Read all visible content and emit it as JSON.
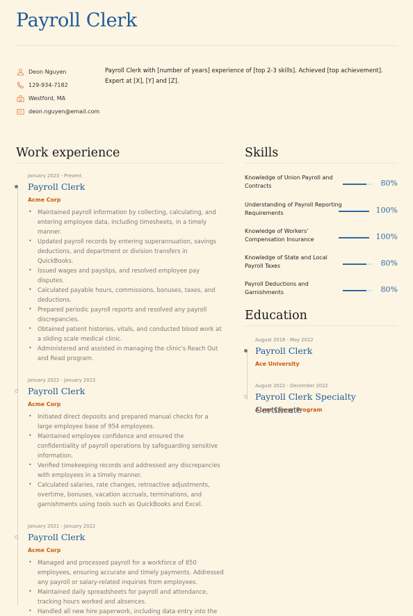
{
  "header": {
    "title": "Payroll Clerk"
  },
  "contact": [
    {
      "icon": "person-icon",
      "text": "Deon Nguyen"
    },
    {
      "icon": "phone-icon",
      "text": "129-934-7182"
    },
    {
      "icon": "location-icon",
      "text": "Westford, MA"
    },
    {
      "icon": "email-icon",
      "text": "deon.nguyen@email.com"
    }
  ],
  "summary": "Payroll Clerk with [number of years] experience of [top 2-3 skills]. Achieved [top achievement]. Expert at [X], [Y] and [Z].",
  "work": {
    "heading": "Work experience",
    "jobs": [
      {
        "date": "January 2023 - Present",
        "title": "Payroll Clerk",
        "company": "Acme Corp",
        "bullets": [
          "Maintained payroll information by collecting, calculating, and entering employee data, including timesheets, in a timely manner.",
          "Updated payroll records by entering superannuation, savings deductions, and department or division transfers in QuickBooks.",
          "Issued wages and payslips, and resolved employee pay disputes.",
          "Calculated payable hours, commissions, bonuses, taxes, and deductions.",
          "Prepared periodic payroll reports and resolved any payroll discrepancies.",
          "Obtained patient histories, vitals, and conducted blood work at a sliding scale medical clinic.",
          "Administered and assisted in managing the clinic's Reach Out and Read program."
        ]
      },
      {
        "date": "January 2022 - January 2023",
        "title": "Payroll Clerk",
        "company": "Acme Corp",
        "bullets": [
          "Initiated direct deposits and prepared manual checks for a large employee base of 954 employees.",
          "Maintained employee confidence and ensured the confidentiality of payroll operations by safeguarding sensitive information.",
          "Verified timekeeping records and addressed any discrepancies with employees in a timely manner.",
          "Calculated salaries, rate changes, retroactive adjustments, overtime, bonuses, vacation accruals, terminations, and garnishments using tools such as QuickBooks and Excel."
        ]
      },
      {
        "date": "January 2021 - January 2022",
        "title": "Payroll Clerk",
        "company": "Acme Corp",
        "bullets": [
          "Managed and processed payroll for a workforce of 850 employees, ensuring accurate and timely payments. Addressed any payroll or salary-related inquiries from employees.",
          "Maintained daily spreadsheets for payroll and attendance, tracking hours worked and absences.",
          "Handled all new hire paperwork, including data entry into the"
        ]
      }
    ]
  },
  "skills": {
    "heading": "Skills",
    "items": [
      {
        "name": "Knowledge of Union Payroll and Contracts",
        "level": 0.8,
        "label": "80%"
      },
      {
        "name": "Understanding of Payroll Reporting Requirements",
        "level": 1.0,
        "label": "100%"
      },
      {
        "name": "Knowledge of Workers' Compensation Insurance",
        "level": 1.0,
        "label": "100%"
      },
      {
        "name": "Knowledge of State and Local Payroll Taxes",
        "level": 0.8,
        "label": "80%"
      },
      {
        "name": "Payroll Deductions and Garnishments",
        "level": 0.8,
        "label": "80%"
      }
    ]
  },
  "education": {
    "heading": "Education",
    "items": [
      {
        "date": "August 2018 - May 2022",
        "title": "Payroll Clerk",
        "school": "Ace University"
      },
      {
        "date": "August 2022 - December 2022",
        "title": "Payroll Clerk Specialty Certificate",
        "school": "Acme Career Program"
      }
    ]
  },
  "colors": {
    "accent": "#1e5a97",
    "company": "#c85a10",
    "icon": "#e08a4f",
    "background": "#fdf5e4"
  }
}
